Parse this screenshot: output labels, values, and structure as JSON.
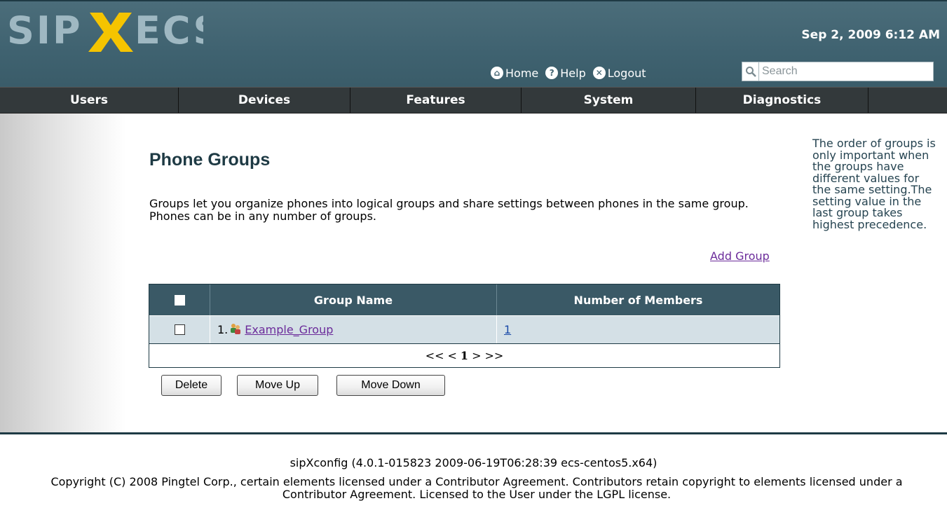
{
  "header": {
    "logo_text": "SIPXECS",
    "datetime": "Sep 2, 2009 6:12 AM",
    "links": [
      {
        "label": "Home",
        "icon": "home-icon"
      },
      {
        "label": "Help",
        "icon": "help-icon"
      },
      {
        "label": "Logout",
        "icon": "logout-icon"
      }
    ],
    "search": {
      "placeholder": "Search",
      "value": ""
    }
  },
  "nav": {
    "items": [
      "Users",
      "Devices",
      "Features",
      "System",
      "Diagnostics"
    ]
  },
  "main": {
    "title": "Phone Groups",
    "intro": "Groups let you organize phones into logical groups and share settings between phones in the same group. Phones can be in any number of groups.",
    "add_group_label": "Add Group",
    "sidenote": "The order of groups is only important when the groups have different values for the same setting.The setting value in the last group takes highest precedence.",
    "table": {
      "columns": [
        "",
        "Group Name",
        "Number of Members"
      ],
      "rows": [
        {
          "index": "1.",
          "name": "Example_Group",
          "members": "1",
          "checked": false
        }
      ],
      "pager": {
        "first": "<<",
        "prev": "<",
        "current": "1",
        "next": ">",
        "last": ">>"
      }
    },
    "buttons": {
      "delete": "Delete",
      "move_up": "Move Up",
      "move_down": "Move Down"
    }
  },
  "footer": {
    "version": "sipXconfig (4.0.1-015823 2009-06-19T06:28:39 ecs-centos5.x64)",
    "copyright": "Copyright (C) 2008 Pingtel Corp., certain elements licensed under a Contributor Agreement. Contributors retain copyright to elements licensed under a Contributor Agreement. Licensed to the User under the LGPL license."
  },
  "colors": {
    "header_bg": "#3f6270",
    "nav_bg": "#33393b",
    "table_header_bg": "#3a5966",
    "row_bg": "#d4e0e6",
    "logo_accent": "#f5c400",
    "link_visited": "#6b2b9a"
  }
}
